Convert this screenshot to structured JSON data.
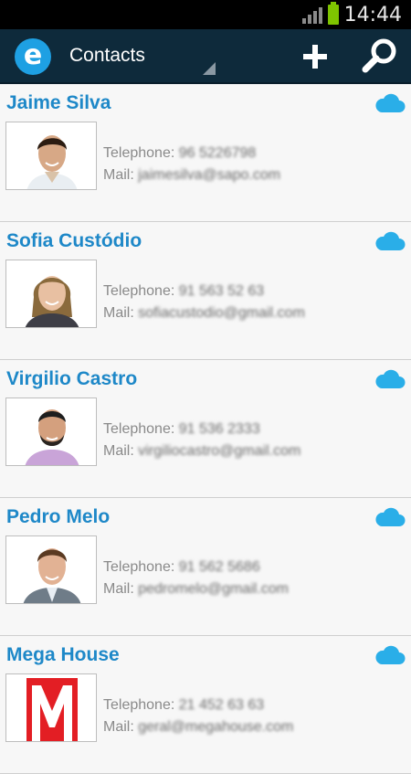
{
  "status_bar": {
    "time": "14:44"
  },
  "action_bar": {
    "title": "Contacts",
    "logo_letter": "e"
  },
  "labels": {
    "telephone": "Telephone:",
    "mail": "Mail:"
  },
  "contacts": [
    {
      "name": "Jaime Silva",
      "phone": "96 5226798",
      "mail": "jaimesilva@sapo.com",
      "avatar": "man-dark-hair"
    },
    {
      "name": "Sofia Custódio",
      "phone": "91 563 52 63",
      "mail": "sofiacustodio@gmail.com",
      "avatar": "woman-blonde"
    },
    {
      "name": "Virgilio Castro",
      "phone": "91 536 2333",
      "mail": "virgiliocastro@gmail.com",
      "avatar": "man-beard"
    },
    {
      "name": "Pedro Melo",
      "phone": "91 562 5686",
      "mail": "pedromelo@gmail.com",
      "avatar": "man-suit"
    },
    {
      "name": "Mega House",
      "phone": "21 452 63 63",
      "mail": "geral@megahouse.com",
      "avatar": "red-m-logo"
    }
  ],
  "colors": {
    "accent": "#1e88c8",
    "cloud": "#2aaee8",
    "action_bar": "#0e2a3b",
    "battery": "#7ec400"
  }
}
